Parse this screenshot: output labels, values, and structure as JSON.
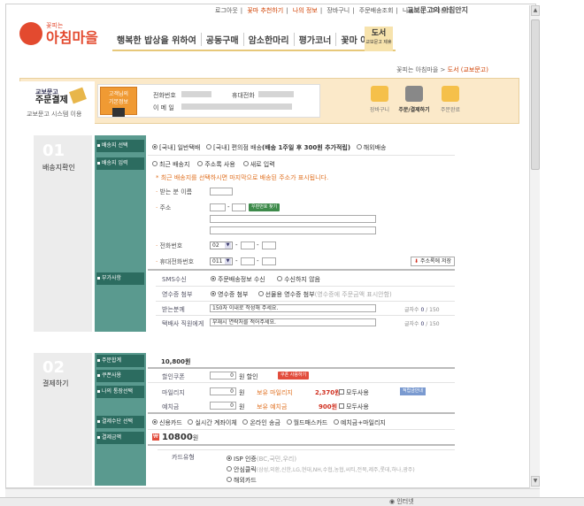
{
  "topnav": {
    "items": [
      "로그아웃",
      "꽃마 추천하기",
      "나의 정보",
      "장바구니",
      "주문배송조회",
      "나눔터",
      "고객센터"
    ],
    "brand": "교보문고의 아침안지"
  },
  "logo": {
    "small": "꽃피는",
    "main": "아침마을"
  },
  "gnb": {
    "items": [
      "행복한 밥상을 위하여",
      "공동구매",
      "암소한마리",
      "평가코너",
      "꽃마 아트샵"
    ],
    "book_main": "도서",
    "book_sub": "교보문고 제휴"
  },
  "breadcrumb": {
    "home": "꽃피는 아침마을",
    "sep": " > ",
    "current": "도서 (교보문고)"
  },
  "banner": {
    "kyobo_small": "교보문고",
    "kyobo_title": "주문결제",
    "kyobo_sub": "교보문고 시스템 이용",
    "grade_label1": "고객님의",
    "grade_label2": "기본정보",
    "phone_label": "전화번호",
    "mobile_label": "휴대전화",
    "email_label": "이 메 일",
    "steps": [
      "장바구니",
      "주문/결제하기",
      "주문완료"
    ]
  },
  "section1": {
    "num": "01",
    "title": "배송지확인",
    "ship_method_label": "배송지 선택",
    "ship_methods": [
      "[국내] 일반택배",
      "[국내] 편의점 배송",
      "해외배송"
    ],
    "conv_note": "(배송 1주일 후 300원 추가적립)",
    "address_label": "배송지 입력",
    "address_opts": [
      "최근 배송지",
      "주소록 사용",
      "새로 입력"
    ],
    "address_notice": "* 최근 배송지를 선택하시면 마지막으로 배송된 주소가 표시됩니다.",
    "recipient_label": "받는 분 이름",
    "addr_label": "주소",
    "zip_sep": "-",
    "zip_button": "우편번호 찾기",
    "phone_label": "전화번호",
    "phone_area": "02",
    "mobile_label": "휴대전화번호",
    "mobile_prefix": "011",
    "save_button": "주소록에 저장",
    "extra_label": "부가사항",
    "sms_label": "SMS수신",
    "sms_opts": [
      "주문배송정보 수신",
      "수신하지 않음"
    ],
    "receipt_label": "영수증 첨부",
    "receipt_opts": [
      "영수증 첨부",
      "선물용 영수증 첨부"
    ],
    "receipt_hint": "(영수증에 주문금액 표시안함)",
    "memo_label": "받는분께",
    "memo_value": "150자 이내로 작성해 주세요.",
    "memo_count_label": "글자수",
    "memo_count": "0",
    "memo_max": "/ 150",
    "courier_label": "택배사 직원에게",
    "courier_value": "부재시 연락처를 적어주세요."
  },
  "section2": {
    "num": "02",
    "title": "결제하기",
    "total_label": "주문합계",
    "total_value": "10,800원",
    "coupon_side": "쿠폰사용",
    "coupon_label": "할인쿠폰",
    "coupon_amount": "0",
    "coupon_suffix": "원 할인",
    "coupon_button": "쿠폰 사용하기",
    "assets_side": "나의 통장선택",
    "mileage_label": "마일리지",
    "mileage_value": "0",
    "won": "원",
    "mileage_have": "보유 마일리지",
    "mileage_have_value": "2,370원",
    "use_all": "모두사용",
    "mileage_btn": "적립금안내",
    "deposit_label": "예치금",
    "deposit_value": "0",
    "deposit_have": "보유 예치금",
    "deposit_have_value": "900원",
    "pay_method_label": "결제수단 선택",
    "pay_methods": [
      "신용카드",
      "실시간 계좌이체",
      "온라인 송금",
      "월드패스카드",
      "예치금+마일리지"
    ],
    "amount_label": "결제금액",
    "amount_value": "10800",
    "amount_suffix": "원",
    "card_type_label": "카드유형",
    "card_opts": [
      "ISP 인증",
      "안심클릭",
      "해외카드"
    ],
    "isp_hint": "(BC,국민,우리)",
    "safe_hint": "(삼성,외환,신한,LG,현대,NH,수협,농협,씨티,전북,제주,롯데,하나,광주)"
  },
  "statusbar": {
    "text": "인터넷"
  }
}
